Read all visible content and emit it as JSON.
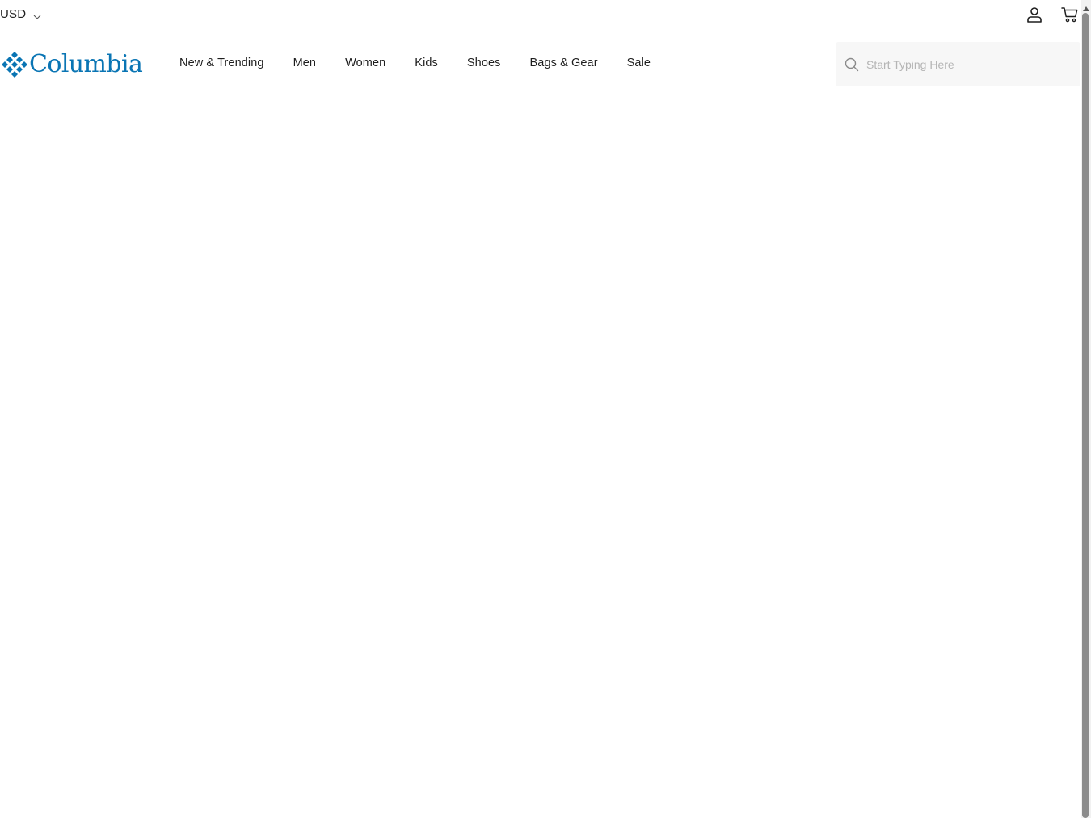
{
  "utility_bar": {
    "currency": "USD",
    "icons": {
      "currency_dropdown": "chevron-down-icon",
      "account": "user-icon",
      "cart": "cart-icon"
    }
  },
  "header": {
    "logo_text": "Columbia",
    "logo_mark": "diamond-grid-logo",
    "nav": [
      {
        "label": "New & Trending"
      },
      {
        "label": "Men"
      },
      {
        "label": "Women"
      },
      {
        "label": "Kids"
      },
      {
        "label": "Shoes"
      },
      {
        "label": "Bags & Gear"
      },
      {
        "label": "Sale"
      }
    ],
    "search": {
      "placeholder": "Start Typing Here",
      "value": "",
      "icon": "search-icon"
    }
  },
  "colors": {
    "brand": "#0a75b4",
    "text": "#1e1e1e",
    "divider": "#e3e3e3",
    "search_bg": "#f7f7f7",
    "placeholder": "#b5b5b5"
  }
}
